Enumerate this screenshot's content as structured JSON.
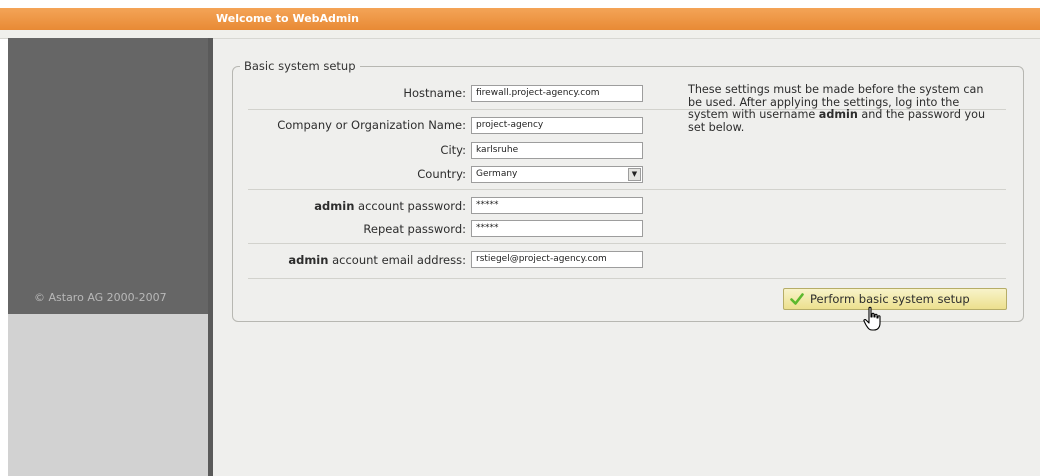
{
  "header": {
    "title": "Welcome to WebAdmin"
  },
  "sidebar": {
    "copyright": "© Astaro AG 2000-2007"
  },
  "form": {
    "legend": "Basic system setup",
    "hostname": {
      "label": "Hostname:",
      "value": "firewall.project-agency.com"
    },
    "company": {
      "label": "Company or Organization Name:",
      "value": "project-agency"
    },
    "city": {
      "label": "City:",
      "value": "karlsruhe"
    },
    "country": {
      "label": "Country:",
      "value": "Germany"
    },
    "admin_password": {
      "label_bold": "admin",
      "label_rest": " account password:",
      "value": "*****"
    },
    "repeat_password": {
      "label": "Repeat password:",
      "value": "*****"
    },
    "admin_email": {
      "label_bold": "admin",
      "label_rest": " account email address:",
      "value": "rstiegel@project-agency.com"
    },
    "info": {
      "part1": "These settings must be made before the system can be used. After applying the settings, log into the system with username ",
      "bold": "admin",
      "part2": " and the password you set below."
    },
    "submit_label": "Perform basic system setup"
  },
  "colors": {
    "header_orange": "#e88a35",
    "sidebar_dark": "#666666",
    "button_yellow": "#ece08e",
    "check_green": "#5cb82e"
  },
  "icons": {
    "submit": "checkmark-icon",
    "pointer": "hand-cursor-icon",
    "dropdown": "dropdown-arrow-icon"
  }
}
